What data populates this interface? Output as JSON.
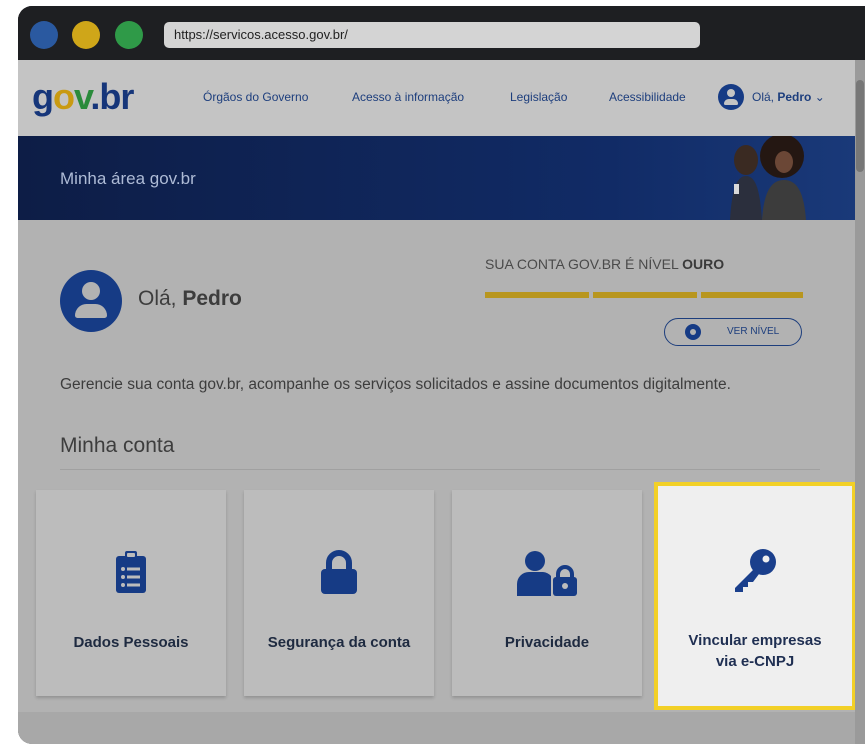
{
  "browser": {
    "url": "https://servicos.acesso.gov.br/"
  },
  "header": {
    "logo": {
      "g": "g",
      "o": "o",
      "v": "v",
      "dot": ".",
      "br": "br"
    },
    "nav": [
      {
        "label": "Órgãos do Governo"
      },
      {
        "label": "Acesso à informação"
      },
      {
        "label": "Legislação"
      },
      {
        "label": "Acessibilidade"
      }
    ],
    "greeting_prefix": "Olá,",
    "user_name": "Pedro",
    "chevron": "⌄"
  },
  "banner": {
    "title": "Minha área gov.br"
  },
  "profile": {
    "greeting_prefix": "Olá,",
    "name": "Pedro"
  },
  "level": {
    "prefix": "SUA CONTA GOV.BR É NÍVEL",
    "value": "OURO",
    "ver_nivel_label": "VER NÍVEL"
  },
  "description": "Gerencie sua conta gov.br, acompanhe os serviços solicitados e assine documentos digitalmente.",
  "section_title": "Minha conta",
  "cards": [
    {
      "label": "Dados Pessoais",
      "icon": "clipboard-icon"
    },
    {
      "label": "Segurança da conta",
      "icon": "lock-icon"
    },
    {
      "label": "Privacidade",
      "icon": "user-lock-icon"
    },
    {
      "label_line1": "Vincular empresas",
      "label_line2": "via e-CNPJ",
      "icon": "key-icon"
    }
  ],
  "colors": {
    "primary": "#163b85",
    "gold": "#b8961f",
    "highlight": "#f2d027"
  }
}
